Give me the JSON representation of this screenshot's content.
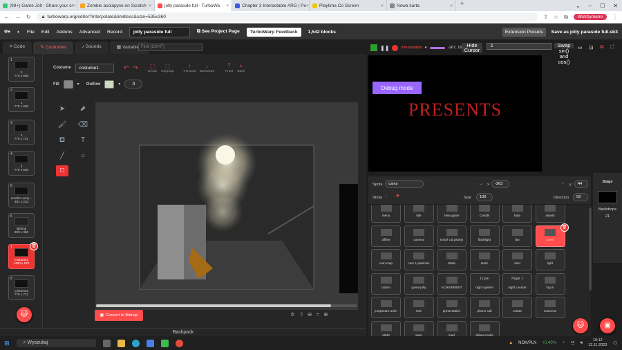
{
  "browser": {
    "tabs": [
      {
        "title": "(99+) Game Jolt - Share your cr",
        "color": "#2ecc71"
      },
      {
        "title": "Zombie acolapyse on Scratch",
        "color": "#f5a623"
      },
      {
        "title": "jolly paraside full - TurboWa",
        "color": "#ff4c4c"
      },
      {
        "title": "Chapter 3 Interactable ARG | Po",
        "color": "#3b5bdb"
      },
      {
        "title": "Playtime.Co Screen",
        "color": "#f1c40f"
      },
      {
        "title": "Nowa karta",
        "color": "#888888"
      }
    ],
    "url": "turbowarp.org/editor?interpolate&limitless&size=535x360",
    "profile": "Wstrzymano"
  },
  "menubar": {
    "items": [
      "File",
      "Edit",
      "Addons",
      "Advanced",
      "Record"
    ],
    "project_title": "jolly paraside full",
    "see_project_page": "See Project Page",
    "feedback": "TurboWarp Feedback",
    "blocks": "1,542 blocks",
    "extension_presets": "Extension Presets",
    "save_as": "Save as jolly paraside full.sb3"
  },
  "editor_tabs": [
    "Code",
    "Costumes",
    "Sounds",
    "Variables"
  ],
  "find_placeholder": "Find (Ctrl+F)",
  "costumes": [
    {
      "num": "1",
      "name": "0",
      "size": "770 x 600"
    },
    {
      "num": "2",
      "name": "1",
      "size": "770 x 600"
    },
    {
      "num": "3",
      "name": "2",
      "size": "770 x 721"
    },
    {
      "num": "4",
      "name": "3",
      "size": "770 x 600"
    },
    {
      "num": "5",
      "name": "another wmp...",
      "size": "361 x 232"
    },
    {
      "num": "6",
      "name": "lighting",
      "size": "300 x 366"
    },
    {
      "num": "7",
      "name": "costume1",
      "size": "1400 x 670"
    },
    {
      "num": "8",
      "name": "costume2",
      "size": "770 x 721"
    }
  ],
  "paint": {
    "costume_label": "Costume",
    "costume_name": "costume1",
    "group": "Group",
    "ungroup": "Ungroup",
    "forward": "Forward",
    "backward": "Backward",
    "front": "Front",
    "back": "Back",
    "fill_label": "Fill",
    "outline_label": "Outline",
    "outline_width": "0",
    "convert": "Convert to Bitmap",
    "fill_color": "#888888",
    "outline_color": "#cfd8c0"
  },
  "backpack": "Backpack",
  "stage": {
    "interpolation": "Interpolation",
    "coords": "-267, 1600",
    "hide_cursor": [
      "Hide",
      "Cursor"
    ],
    "monitor_value": "-1",
    "swap": [
      "Swap",
      "sin()",
      "and",
      "cos()"
    ],
    "debug_mode": "Debug mode",
    "presents": "PRESENTS"
  },
  "sprite_info": {
    "sprite_label": "Sprite",
    "sprite_name": "cams",
    "x_label": "x",
    "x_value": "-263",
    "y_label": "y",
    "y_value": "44",
    "show_label": "Show",
    "size_label": "Size",
    "size_value": "100",
    "direction_label": "Direction",
    "direction_value": "93"
  },
  "sprites": [
    "menu",
    "title",
    "New game",
    "Credits",
    "fade",
    "assets",
    "offline",
    "camera",
    "smurf cat plushy",
    "flashlight",
    "fan",
    "cams",
    "cam map",
    "cam 1 particles",
    "Static",
    "static",
    "dust",
    "light",
    "button",
    "game jolty",
    "ACHIVEMENT",
    "night system",
    "night counter",
    "log in",
    "jumpscare anim",
    "text",
    "presentation",
    "phone call",
    "extras",
    "cutscene",
    "stickt",
    "save",
    "load",
    "debug mode"
  ],
  "sprite_thumb_text": {
    "night system": "12 pm",
    "night counter": "Night 1"
  },
  "stage_panel": {
    "title": "Stage",
    "backdrops_label": "Backdrops",
    "backdrops_count": "21"
  },
  "taskbar": {
    "search": "Wyszukaj",
    "stock": "NOK/PLN",
    "stock_change": "+0.40%",
    "time": "19:12",
    "date": "13.11.2023"
  }
}
